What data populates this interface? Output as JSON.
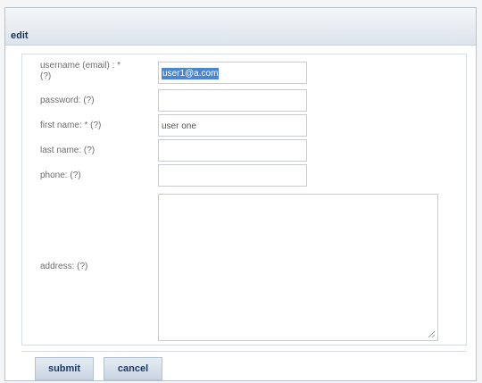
{
  "dialog": {
    "title": "edit"
  },
  "form": {
    "username_label": "username (email) : *\n(?)",
    "username_value": "user1@a.com",
    "password_label": "password: (?)",
    "password_value": "",
    "firstname_label": "first name: * (?)",
    "firstname_value": "user one",
    "lastname_label": "last name: (?)",
    "lastname_value": "",
    "phone_label": "phone: (?)",
    "phone_value": "",
    "address_label": "address: (?)",
    "address_value": ""
  },
  "buttons": {
    "submit": "submit",
    "cancel": "cancel"
  },
  "icons": {
    "resize_grip": "resize-grip-icon"
  }
}
